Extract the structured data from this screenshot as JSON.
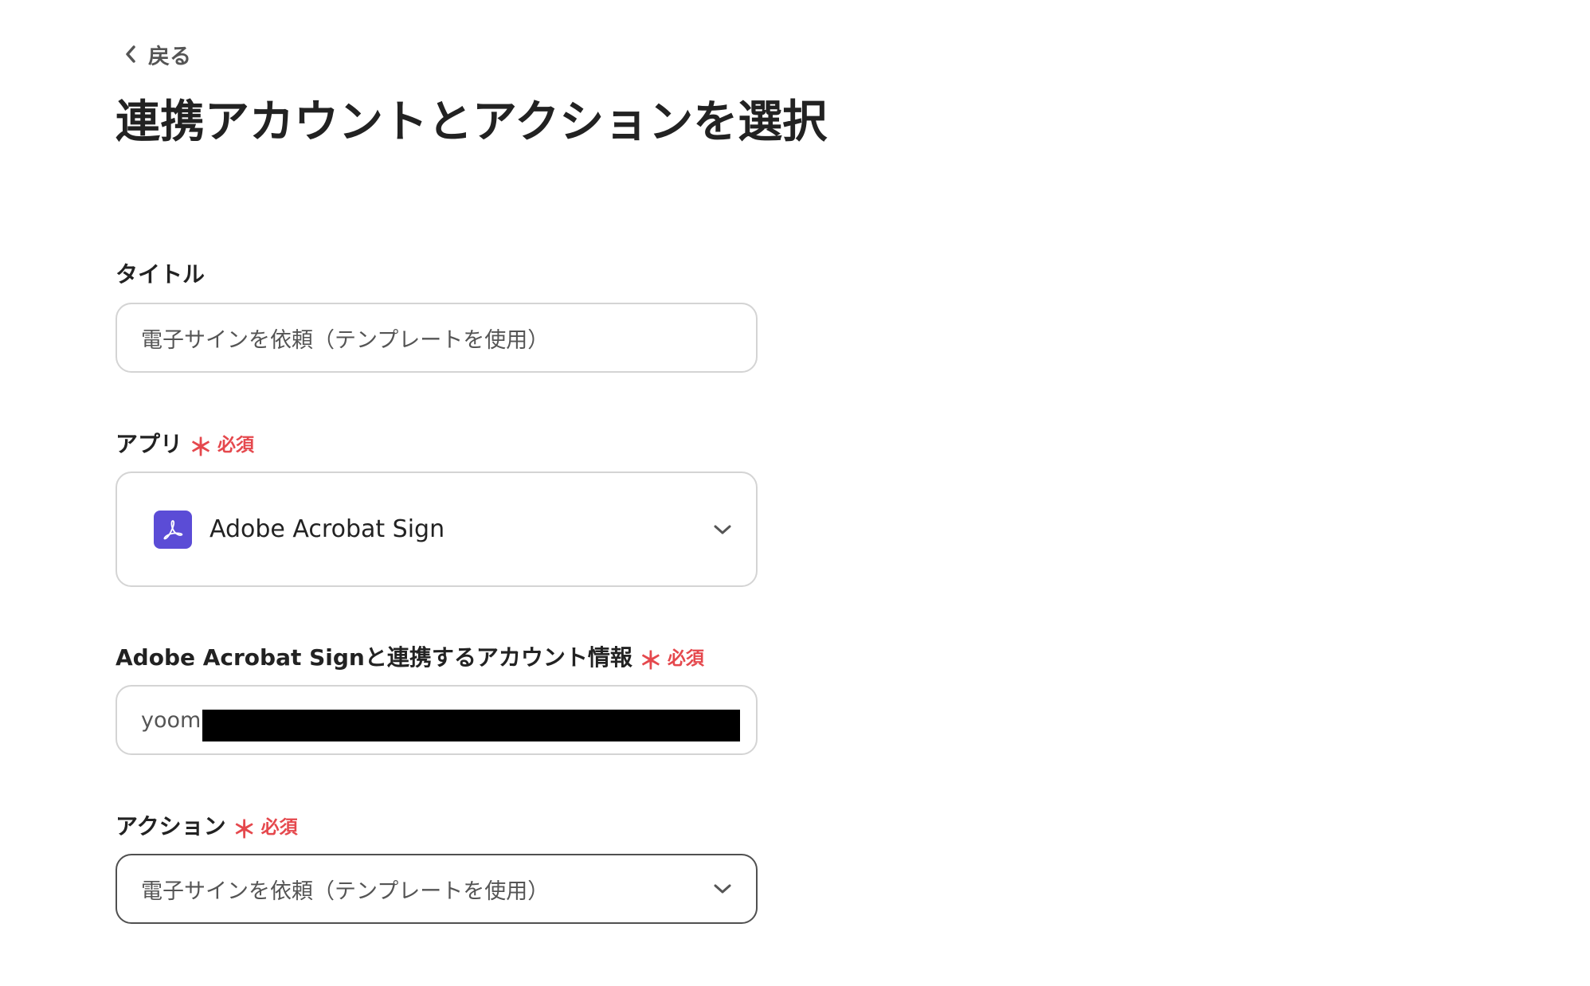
{
  "back": {
    "label": "戻る",
    "icon": "chevron-left-icon"
  },
  "page": {
    "title": "連携アカウントとアクションを選択"
  },
  "form": {
    "required_mark": "＊",
    "required_label": "必須",
    "title_field": {
      "label": "タイトル",
      "value": "電子サインを依頼（テンプレートを使用）"
    },
    "app_field": {
      "label": "アプリ",
      "value": "Adobe Acrobat Sign",
      "icon": "adobe-acrobat-icon",
      "icon_color": "#5b4cd6"
    },
    "account_field": {
      "label": "Adobe Acrobat Signと連携するアカウント情報",
      "value": "yoom"
    },
    "action_field": {
      "label": "アクション",
      "value": "電子サインを依頼（テンプレートを使用）"
    }
  },
  "colors": {
    "required": "#e5484d",
    "border": "#d4d4d4",
    "border_active": "#505050"
  }
}
